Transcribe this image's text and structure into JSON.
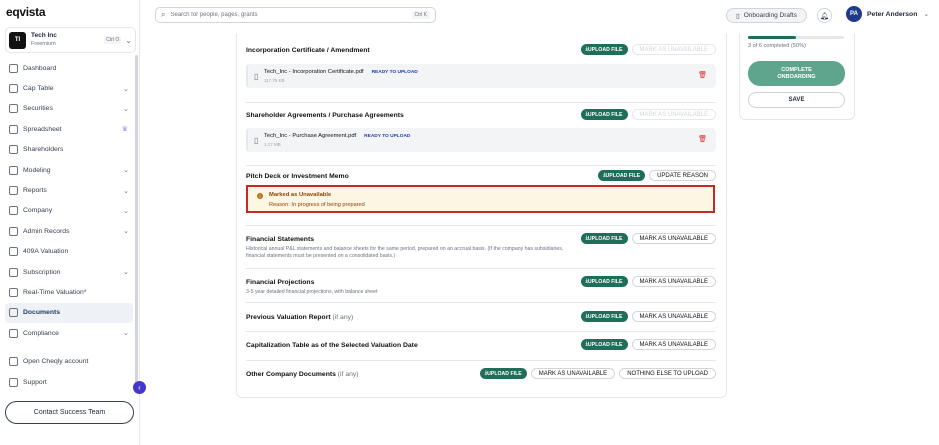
{
  "app": {
    "logo": "eqvista"
  },
  "company": {
    "badge": "TI",
    "name": "Tech Inc",
    "plan": "Freemium",
    "shortcut": "Ctrl O"
  },
  "sidebar": {
    "items": [
      {
        "label": "Dashboard",
        "caret": false
      },
      {
        "label": "Cap Table",
        "caret": true
      },
      {
        "label": "Securities",
        "caret": true
      },
      {
        "label": "Spreadsheet",
        "caret": false,
        "crown": true
      },
      {
        "label": "Shareholders",
        "caret": false
      },
      {
        "label": "Modeling",
        "caret": true
      },
      {
        "label": "Reports",
        "caret": true
      },
      {
        "label": "Company",
        "caret": true
      },
      {
        "label": "Admin Records",
        "caret": true
      },
      {
        "label": "409A Valuation",
        "caret": false
      },
      {
        "label": "Subscription",
        "caret": true
      },
      {
        "label": "Real-Time Valuation*",
        "caret": false
      },
      {
        "label": "Documents",
        "caret": false,
        "active": true
      },
      {
        "label": "Compliance",
        "caret": true
      },
      {
        "label": "Open Cheqly account",
        "caret": false
      },
      {
        "label": "Support",
        "caret": false
      }
    ],
    "contact_label": "Contact Success Team"
  },
  "header": {
    "search_placeholder": "Search for people, pages, grants",
    "search_shortcut": "Ctrl K",
    "drafts_label": "Onboarding Drafts",
    "user_initials": "PA",
    "user_name": "Peter Anderson"
  },
  "labels": {
    "upload": "UPLOAD FILE",
    "mark_unavailable": "MARK AS UNAVAILABLE",
    "update_reason": "UPDATE REASON",
    "nothing_else": "NOTHING ELSE TO UPLOAD",
    "ready": "READY TO UPLOAD"
  },
  "documents": {
    "incorporation": {
      "title": "Incorporation Certificate / Amendment",
      "file": "Tech_Inc - Incorporation Certificate.pdf",
      "size": "117.76 KB"
    },
    "shareholder": {
      "title": "Shareholder Agreements / Purchase Agreements",
      "file": "Tech_Inc - Purchase Agreement.pdf",
      "size": "1.17 MB"
    },
    "pitch": {
      "title": "Pitch Deck or Investment Memo",
      "unavailable_title": "Marked as Unavailable",
      "unavailable_reason": "Reason: In progress of being prepared"
    },
    "financial_statements": {
      "title": "Financial Statements",
      "desc": "Historical annual P&L statements and balance sheets for the same period, prepared on an accrual basis. (If the company has subsidiaries, financial statements must be presented on a consolidated basis.)"
    },
    "financial_projections": {
      "title": "Financial Projections",
      "desc": "3-5 year detailed financial projections, with balance sheet"
    },
    "prev_valuation": {
      "title": "Previous Valuation Report",
      "opt": "(if any)"
    },
    "cap_table": {
      "title": "Capitalization Table as of the Selected Valuation Date"
    },
    "other": {
      "title": "Other Company Documents",
      "opt": "(if any)"
    }
  },
  "progress": {
    "text": "3 of 6 completed (50%)",
    "fraction": 0.5,
    "complete_label": "COMPLETE ONBOARDING",
    "save_label": "SAVE"
  },
  "colors": {
    "primary": "#1f6e5a",
    "accent": "#4338ca",
    "alert_border": "#c62828"
  }
}
